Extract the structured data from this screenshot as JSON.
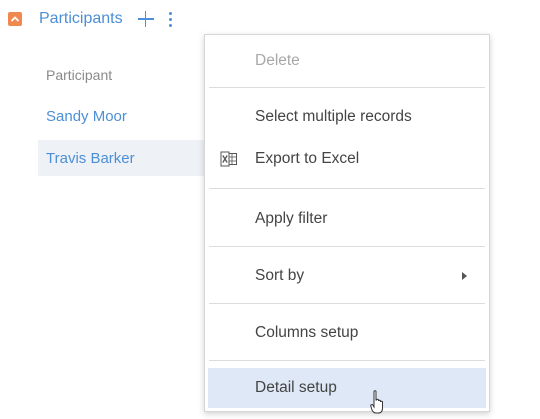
{
  "detail": {
    "title": "Participants",
    "toggle_icon": "chevron-up-icon",
    "add_icon": "plus-icon",
    "actions_icon": "kebab-menu-icon",
    "accent_color": "#4d8fd6",
    "toggle_color": "#f0894f"
  },
  "grid": {
    "column_header": "Participant",
    "rows": [
      {
        "name": "Sandy Moor"
      },
      {
        "name": "Travis Barker"
      }
    ]
  },
  "menu": {
    "items": [
      {
        "label": "Delete",
        "disabled": true
      },
      {
        "label": "Select multiple records"
      },
      {
        "label": "Export to Excel",
        "icon": "excel-icon"
      },
      {
        "label": "Apply filter"
      },
      {
        "label": "Sort by",
        "has_submenu": true
      },
      {
        "label": "Columns setup"
      },
      {
        "label": "Detail setup",
        "highlighted": true
      }
    ],
    "highlight_color": "#dfe8f6"
  }
}
